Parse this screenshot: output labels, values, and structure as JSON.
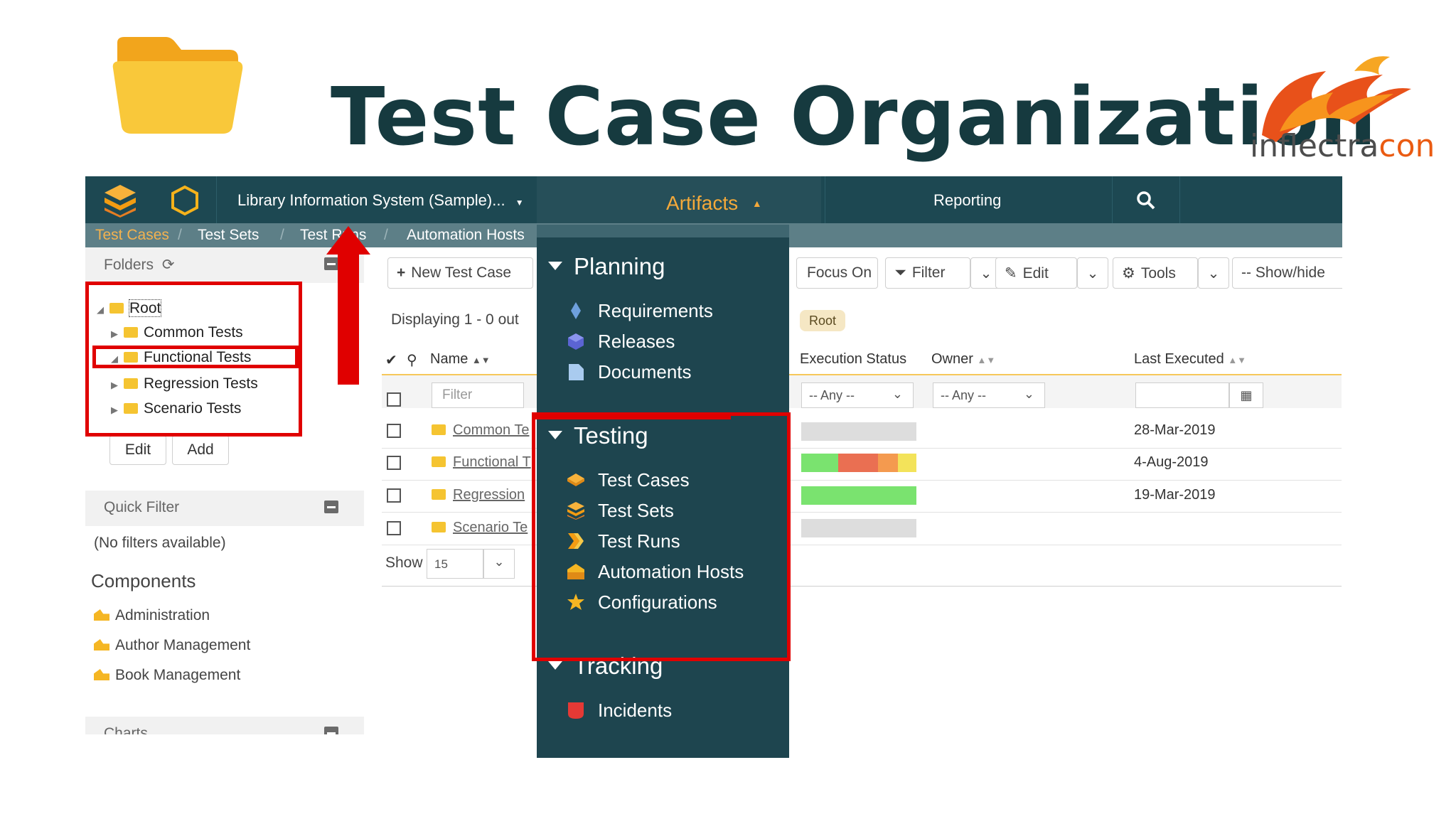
{
  "slide": {
    "title": "Test Case Organization"
  },
  "brand": {
    "name_part1": "inflectra",
    "name_part2": "con"
  },
  "colors": {
    "nav_dark": "#1d4852",
    "accent_orange": "#f4a93a",
    "callout_red": "#e00000",
    "folder_yellow": "#f5c431"
  },
  "app": {
    "project_name": "Library Information System (Sample)...",
    "nav": {
      "artifacts": "Artifacts",
      "reporting": "Reporting"
    },
    "subnav": [
      "Test Cases",
      "Test Sets",
      "Test Runs",
      "Automation Hosts"
    ],
    "left": {
      "folders_label": "Folders",
      "tree": [
        "Root",
        "Common Tests",
        "Functional Tests",
        "Regression Tests",
        "Scenario Tests"
      ],
      "edit_button": "Edit",
      "add_button": "Add",
      "quick_filter_label": "Quick Filter",
      "no_filters": "(No filters available)",
      "components_label": "Components",
      "components": [
        "Administration",
        "Author Management",
        "Book Management"
      ],
      "charts_label": "Charts"
    },
    "toolbar": {
      "new_test_case": "New Test Case",
      "focus_on": "Focus On",
      "filter": "Filter",
      "edit": "Edit",
      "tools": "Tools",
      "show_hide": "-- Show/hide"
    },
    "displaying": "Displaying 1 - 0 out",
    "root_badge": "Root",
    "columns": {
      "name": "Name",
      "execution_status": "Execution Status",
      "owner": "Owner",
      "last_executed": "Last Executed"
    },
    "filters": {
      "name_placeholder": "Filter",
      "status_any": "-- Any --",
      "owner_any": "-- Any --"
    },
    "rows": [
      {
        "name": "Common Te",
        "last_executed": "28-Mar-2019"
      },
      {
        "name": "Functional T",
        "last_executed": "4-Aug-2019"
      },
      {
        "name": "Regression",
        "last_executed": "19-Mar-2019"
      },
      {
        "name": "Scenario Te",
        "last_executed": ""
      }
    ],
    "show_label": "Show",
    "page_size": "15"
  },
  "menu": {
    "sections": [
      {
        "title": "Planning",
        "items": [
          "Requirements",
          "Releases",
          "Documents"
        ]
      },
      {
        "title": "Testing",
        "items": [
          "Test Cases",
          "Test Sets",
          "Test Runs",
          "Automation Hosts",
          "Configurations"
        ]
      },
      {
        "title": "Tracking",
        "items": [
          "Incidents"
        ]
      }
    ]
  }
}
